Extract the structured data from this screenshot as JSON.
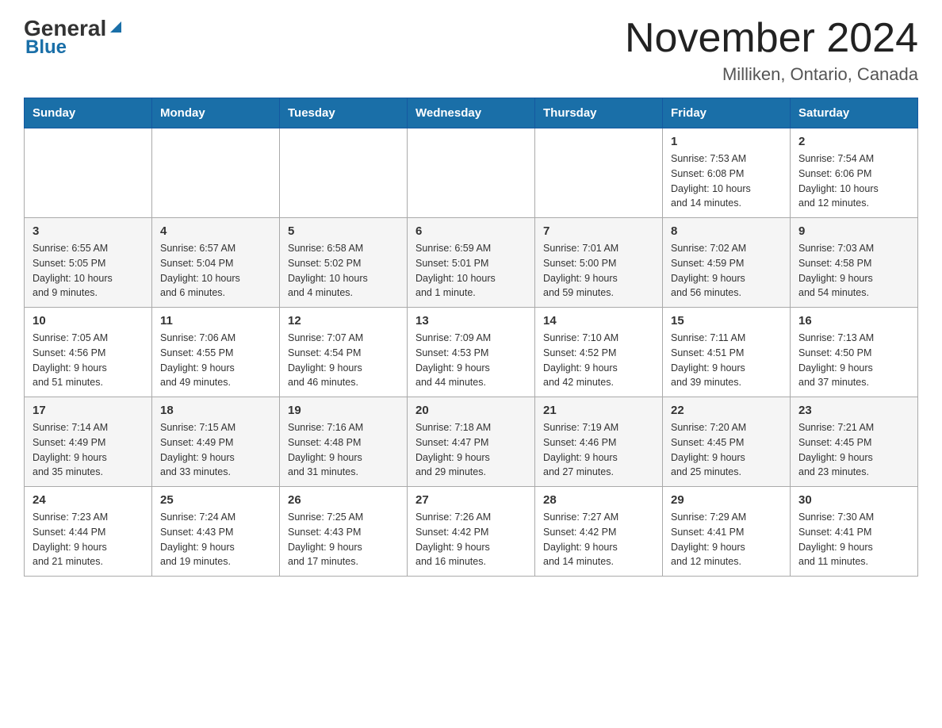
{
  "header": {
    "logo_general": "General",
    "logo_blue": "Blue",
    "title": "November 2024",
    "subtitle": "Milliken, Ontario, Canada"
  },
  "days_of_week": [
    "Sunday",
    "Monday",
    "Tuesday",
    "Wednesday",
    "Thursday",
    "Friday",
    "Saturday"
  ],
  "weeks": [
    {
      "days": [
        {
          "num": "",
          "info": ""
        },
        {
          "num": "",
          "info": ""
        },
        {
          "num": "",
          "info": ""
        },
        {
          "num": "",
          "info": ""
        },
        {
          "num": "",
          "info": ""
        },
        {
          "num": "1",
          "info": "Sunrise: 7:53 AM\nSunset: 6:08 PM\nDaylight: 10 hours\nand 14 minutes."
        },
        {
          "num": "2",
          "info": "Sunrise: 7:54 AM\nSunset: 6:06 PM\nDaylight: 10 hours\nand 12 minutes."
        }
      ]
    },
    {
      "days": [
        {
          "num": "3",
          "info": "Sunrise: 6:55 AM\nSunset: 5:05 PM\nDaylight: 10 hours\nand 9 minutes."
        },
        {
          "num": "4",
          "info": "Sunrise: 6:57 AM\nSunset: 5:04 PM\nDaylight: 10 hours\nand 6 minutes."
        },
        {
          "num": "5",
          "info": "Sunrise: 6:58 AM\nSunset: 5:02 PM\nDaylight: 10 hours\nand 4 minutes."
        },
        {
          "num": "6",
          "info": "Sunrise: 6:59 AM\nSunset: 5:01 PM\nDaylight: 10 hours\nand 1 minute."
        },
        {
          "num": "7",
          "info": "Sunrise: 7:01 AM\nSunset: 5:00 PM\nDaylight: 9 hours\nand 59 minutes."
        },
        {
          "num": "8",
          "info": "Sunrise: 7:02 AM\nSunset: 4:59 PM\nDaylight: 9 hours\nand 56 minutes."
        },
        {
          "num": "9",
          "info": "Sunrise: 7:03 AM\nSunset: 4:58 PM\nDaylight: 9 hours\nand 54 minutes."
        }
      ]
    },
    {
      "days": [
        {
          "num": "10",
          "info": "Sunrise: 7:05 AM\nSunset: 4:56 PM\nDaylight: 9 hours\nand 51 minutes."
        },
        {
          "num": "11",
          "info": "Sunrise: 7:06 AM\nSunset: 4:55 PM\nDaylight: 9 hours\nand 49 minutes."
        },
        {
          "num": "12",
          "info": "Sunrise: 7:07 AM\nSunset: 4:54 PM\nDaylight: 9 hours\nand 46 minutes."
        },
        {
          "num": "13",
          "info": "Sunrise: 7:09 AM\nSunset: 4:53 PM\nDaylight: 9 hours\nand 44 minutes."
        },
        {
          "num": "14",
          "info": "Sunrise: 7:10 AM\nSunset: 4:52 PM\nDaylight: 9 hours\nand 42 minutes."
        },
        {
          "num": "15",
          "info": "Sunrise: 7:11 AM\nSunset: 4:51 PM\nDaylight: 9 hours\nand 39 minutes."
        },
        {
          "num": "16",
          "info": "Sunrise: 7:13 AM\nSunset: 4:50 PM\nDaylight: 9 hours\nand 37 minutes."
        }
      ]
    },
    {
      "days": [
        {
          "num": "17",
          "info": "Sunrise: 7:14 AM\nSunset: 4:49 PM\nDaylight: 9 hours\nand 35 minutes."
        },
        {
          "num": "18",
          "info": "Sunrise: 7:15 AM\nSunset: 4:49 PM\nDaylight: 9 hours\nand 33 minutes."
        },
        {
          "num": "19",
          "info": "Sunrise: 7:16 AM\nSunset: 4:48 PM\nDaylight: 9 hours\nand 31 minutes."
        },
        {
          "num": "20",
          "info": "Sunrise: 7:18 AM\nSunset: 4:47 PM\nDaylight: 9 hours\nand 29 minutes."
        },
        {
          "num": "21",
          "info": "Sunrise: 7:19 AM\nSunset: 4:46 PM\nDaylight: 9 hours\nand 27 minutes."
        },
        {
          "num": "22",
          "info": "Sunrise: 7:20 AM\nSunset: 4:45 PM\nDaylight: 9 hours\nand 25 minutes."
        },
        {
          "num": "23",
          "info": "Sunrise: 7:21 AM\nSunset: 4:45 PM\nDaylight: 9 hours\nand 23 minutes."
        }
      ]
    },
    {
      "days": [
        {
          "num": "24",
          "info": "Sunrise: 7:23 AM\nSunset: 4:44 PM\nDaylight: 9 hours\nand 21 minutes."
        },
        {
          "num": "25",
          "info": "Sunrise: 7:24 AM\nSunset: 4:43 PM\nDaylight: 9 hours\nand 19 minutes."
        },
        {
          "num": "26",
          "info": "Sunrise: 7:25 AM\nSunset: 4:43 PM\nDaylight: 9 hours\nand 17 minutes."
        },
        {
          "num": "27",
          "info": "Sunrise: 7:26 AM\nSunset: 4:42 PM\nDaylight: 9 hours\nand 16 minutes."
        },
        {
          "num": "28",
          "info": "Sunrise: 7:27 AM\nSunset: 4:42 PM\nDaylight: 9 hours\nand 14 minutes."
        },
        {
          "num": "29",
          "info": "Sunrise: 7:29 AM\nSunset: 4:41 PM\nDaylight: 9 hours\nand 12 minutes."
        },
        {
          "num": "30",
          "info": "Sunrise: 7:30 AM\nSunset: 4:41 PM\nDaylight: 9 hours\nand 11 minutes."
        }
      ]
    }
  ]
}
